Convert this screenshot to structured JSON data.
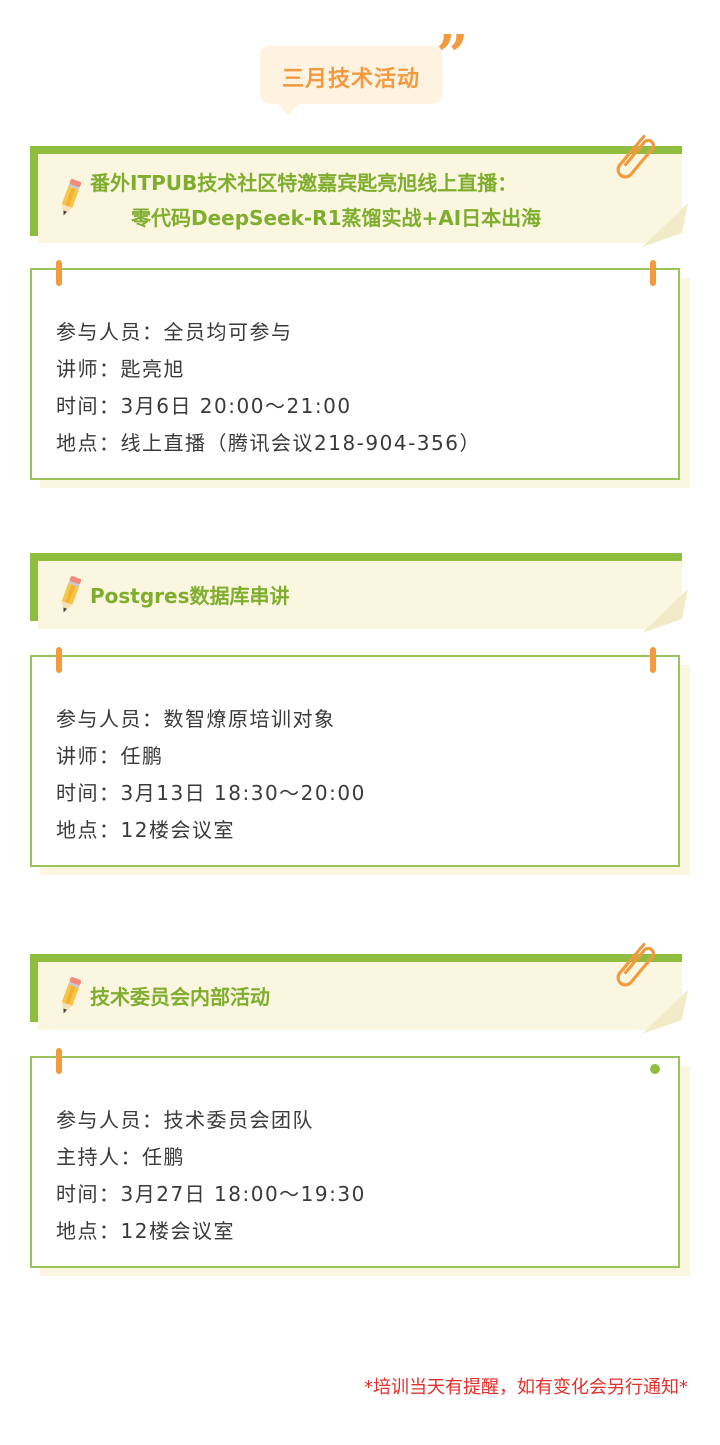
{
  "page_title": "三月技术活动",
  "colors": {
    "accent_orange": "#f39a3e",
    "accent_green": "#8fbd3f",
    "title_green": "#7fae2e",
    "note_red": "#e0312c"
  },
  "events": [
    {
      "title_line1": "番外ITPUB技术社区特邀嘉宾匙亮旭线上直播：",
      "title_line2": "零代码DeepSeek-R1蒸馏实战+AI日本出海",
      "participants": "参与人员：全员均可参与",
      "speaker": "讲师：匙亮旭",
      "time": "时间：3月6日 20:00～21:00",
      "location": "地点：线上直播（腾讯会议218-904-356）"
    },
    {
      "title": "Postgres数据库串讲",
      "participants": "参与人员：数智燎原培训对象",
      "speaker": "讲师：任鹏",
      "time": "时间：3月13日 18:30～20:00",
      "location": "地点：12楼会议室"
    },
    {
      "title": "技术委员会内部活动",
      "participants": "参与人员：技术委员会团队",
      "host": "主持人：任鹏",
      "time": "时间：3月27日 18:00～19:30",
      "location": "地点：12楼会议室"
    }
  ],
  "footer_note": "*培训当天有提醒，如有变化会另行通知*",
  "icons": [
    "pencil-icon",
    "paperclip-icon",
    "quote-icon"
  ]
}
